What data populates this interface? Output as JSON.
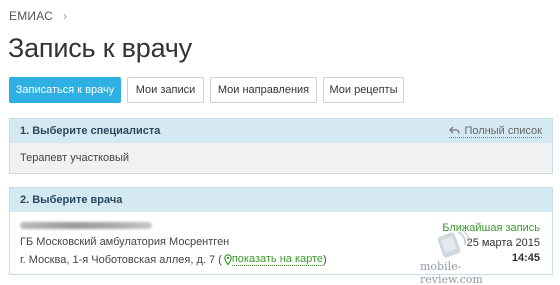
{
  "breadcrumb": {
    "item": "ЕМИАС",
    "separator": "›"
  },
  "page": {
    "title": "Запись к врачу"
  },
  "tabs": [
    {
      "label": "Записаться к врачу",
      "active": true
    },
    {
      "label": "Мои записи",
      "active": false
    },
    {
      "label": "Мои направления",
      "active": false
    },
    {
      "label": "Мои рецепты",
      "active": false
    }
  ],
  "step1": {
    "header": "1. Выберите специалиста",
    "full_list_label": "Полный список",
    "selected": "Терапевт участковый"
  },
  "step2": {
    "header": "2. Выберите врача",
    "doctor": {
      "clinic": "ГБ Московский амбулатория Мосрентген",
      "address": "г. Москва, 1-я Чоботовская аллея, д. 7",
      "map_link": "показать на карте",
      "nearest_label": "Ближайшая запись",
      "date": "25 марта 2015",
      "time": "14:45"
    }
  },
  "watermark": {
    "text": "mobile-review.com"
  },
  "colors": {
    "accent": "#2fb0e3",
    "panel_header": "#d5e9f3",
    "green": "#3c9a2e"
  }
}
